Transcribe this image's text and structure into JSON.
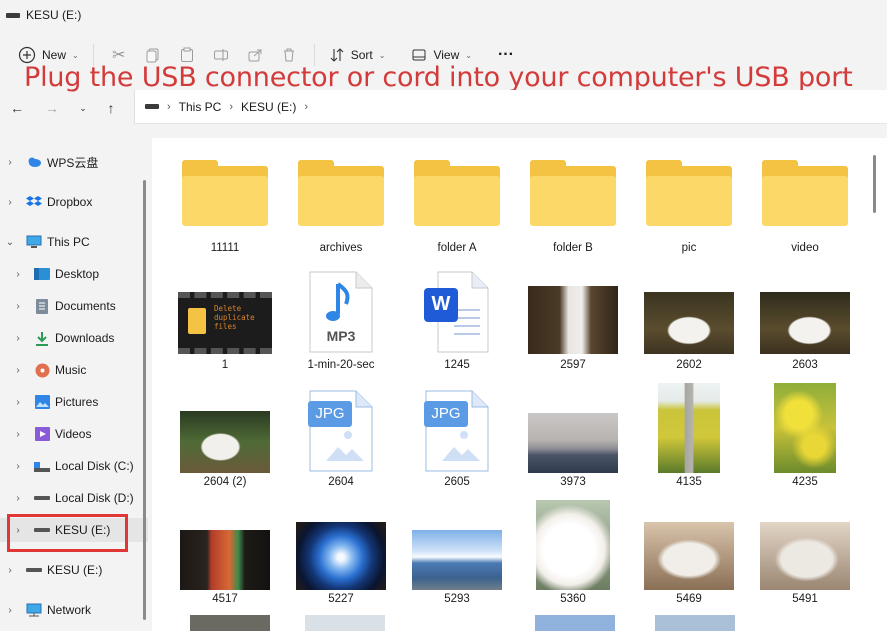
{
  "window": {
    "title": "KESU (E:)"
  },
  "toolbar": {
    "new_label": "New",
    "sort_label": "Sort",
    "view_label": "View",
    "more_label": "···"
  },
  "banner": {
    "text": "Plug the USB connector or cord into your computer's USB port",
    "color": "#d33b3b"
  },
  "address": {
    "crumbs": [
      "This PC",
      "KESU (E:)"
    ]
  },
  "sidebar": {
    "items": [
      {
        "label": "WPS云盘",
        "icon": "cloud-icon"
      },
      {
        "label": "Dropbox",
        "icon": "dropbox-icon"
      },
      {
        "label": "This PC",
        "icon": "pc-icon"
      },
      {
        "label": "Desktop",
        "icon": "desktop-icon"
      },
      {
        "label": "Documents",
        "icon": "documents-icon"
      },
      {
        "label": "Downloads",
        "icon": "downloads-icon"
      },
      {
        "label": "Music",
        "icon": "music-icon"
      },
      {
        "label": "Pictures",
        "icon": "pictures-icon"
      },
      {
        "label": "Videos",
        "icon": "videos-icon"
      },
      {
        "label": "Local Disk (C:)",
        "icon": "drive-icon"
      },
      {
        "label": "Local Disk (D:)",
        "icon": "drive-icon"
      },
      {
        "label": "KESU (E:)",
        "icon": "usb-drive-icon"
      },
      {
        "label": "KESU (E:)",
        "icon": "usb-drive-icon"
      },
      {
        "label": "Network",
        "icon": "network-icon"
      }
    ]
  },
  "files": [
    {
      "name": "11111",
      "kind": "folder"
    },
    {
      "name": "archives",
      "kind": "folder"
    },
    {
      "name": "folder A",
      "kind": "folder"
    },
    {
      "name": "folder B",
      "kind": "folder"
    },
    {
      "name": "pic",
      "kind": "folder"
    },
    {
      "name": "video",
      "kind": "folder"
    },
    {
      "name": "1",
      "kind": "video",
      "thumb_text": "Delete duplicate files"
    },
    {
      "name": "1-min-20-sec",
      "kind": "mp3",
      "badge": "MP3"
    },
    {
      "name": "1245",
      "kind": "word",
      "badge": "W"
    },
    {
      "name": "2597",
      "kind": "photo"
    },
    {
      "name": "2602",
      "kind": "photo"
    },
    {
      "name": "2603",
      "kind": "photo"
    },
    {
      "name": "2604 (2)",
      "kind": "photo"
    },
    {
      "name": "2604",
      "kind": "jpg",
      "badge": "JPG"
    },
    {
      "name": "2605",
      "kind": "jpg",
      "badge": "JPG"
    },
    {
      "name": "3973",
      "kind": "photo"
    },
    {
      "name": "4135",
      "kind": "photo"
    },
    {
      "name": "4235",
      "kind": "photo"
    },
    {
      "name": "4517",
      "kind": "photo"
    },
    {
      "name": "5227",
      "kind": "photo"
    },
    {
      "name": "5293",
      "kind": "photo"
    },
    {
      "name": "5360",
      "kind": "photo"
    },
    {
      "name": "5469",
      "kind": "photo"
    },
    {
      "name": "5491",
      "kind": "photo"
    }
  ]
}
